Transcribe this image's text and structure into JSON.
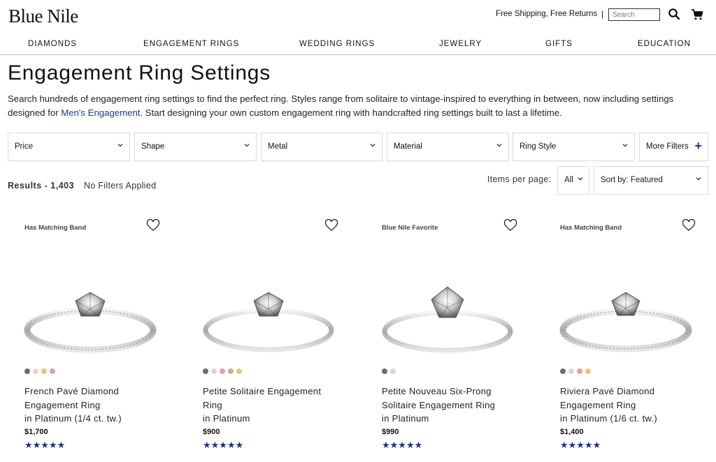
{
  "header": {
    "logo": "Blue Nile",
    "shipping": "Free Shipping, Free Returns",
    "divider": "|",
    "search_placeholder": "Search"
  },
  "nav": [
    "DIAMONDS",
    "ENGAGEMENT RINGS",
    "WEDDING RINGS",
    "JEWELRY",
    "GIFTS",
    "EDUCATION"
  ],
  "page": {
    "title": "Engagement Ring Settings",
    "intro_before": "Search hundreds of engagement ring settings to find the perfect ring. Styles range from solitaire to vintage-inspired to everything in between, now including settings designed for ",
    "intro_link": "Men's Engagement",
    "intro_after": ". Start designing your own custom engagement ring with handcrafted ring settings built to last a lifetime."
  },
  "filters": [
    "Price",
    "Shape",
    "Metal",
    "Material",
    "Ring Style",
    "More Filters"
  ],
  "results": {
    "label": "Results - ",
    "count": "1,403",
    "filters_status": "No Filters Applied",
    "items_per_page_label": "Items per page:",
    "items_per_page_value": "All",
    "sort_value": "Sort by: Featured"
  },
  "colors": {
    "accent": "#1f3a93",
    "star": "#1f2f8a",
    "swatch_dark": "#6b6b6b",
    "swatch_white": "#d8d8d8",
    "swatch_yellow": "#e3c77f",
    "swatch_rose": "#d4a89c"
  },
  "products": [
    {
      "badge": "Has Matching Band",
      "name_line1": "French Pavé Diamond",
      "name_line2": "Engagement Ring",
      "name_line3": "in Platinum (1/4 ct. tw.)",
      "price": "$1,700",
      "stars": "★★★★★",
      "rating": 5,
      "swatches": [
        "dark",
        "white",
        "yellow",
        "rose"
      ]
    },
    {
      "badge": "",
      "name_line1": "Petite Solitaire Engagement",
      "name_line2": "Ring",
      "name_line3": "in Platinum",
      "price": "$900",
      "stars": "★★★★★",
      "rating": 5,
      "swatches": [
        "dark",
        "white",
        "rose",
        "rose",
        "yellow"
      ]
    },
    {
      "badge": "Blue Nile Favorite",
      "name_line1": "Petite Nouveau Six-Prong",
      "name_line2": "Solitaire Engagement Ring",
      "name_line3": "in Platinum",
      "price": "$990",
      "stars": "★★★★★",
      "rating": 5,
      "swatches": [
        "dark",
        "white"
      ]
    },
    {
      "badge": "Has Matching Band",
      "name_line1": "Riviera Pavé Diamond",
      "name_line2": "Engagement Ring",
      "name_line3": "in Platinum (1/6 ct. tw.)",
      "price": "$1,400",
      "stars": "★★★★★",
      "rating": 5,
      "swatches": [
        "dark",
        "white",
        "rose",
        "yellow"
      ]
    }
  ]
}
